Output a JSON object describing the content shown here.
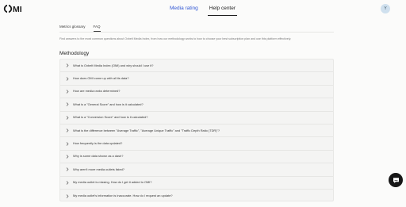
{
  "header": {
    "logo_text": "OMI",
    "nav": [
      {
        "label": "Media rating"
      },
      {
        "label": "Help center"
      }
    ],
    "avatar_initial": "Y",
    "colors": {
      "active_link": "#2f55d4",
      "avatar_bg": "#cfe0ee"
    }
  },
  "subnav": {
    "tabs": [
      {
        "label": "Metrics glossary"
      },
      {
        "label": "FAQ"
      }
    ]
  },
  "intro": "Find answers to the most common questions about Oxbelt Media Index, from how our methodology works to how to choose your best subscription plan and use this platform effectively.",
  "section": {
    "title": "Methodology",
    "questions": [
      "What is Oxbelt Media Index (OMI) and why should I use it?",
      "How does OMI come up with all its data?",
      "How are media ranks determined?",
      "What is a \"General Score\" and how is it calculated?",
      "What is a \"Conversion Score\" and how is it calculated?",
      "What is the difference between \"Average Traffic\", \"Average Unique Traffic\" and \"Traffic Depth Ratio (TDR)\"?",
      "How frequently is the data updated?",
      "Why is some data shown as a dash?",
      "Why aren't more media outlets listed?",
      "My media outlet is missing. How do I get it added to OMI?",
      "My media outlet's information is inaccurate. How do I request an update?"
    ]
  },
  "icons": {
    "faq_chevron": "chevron-right-icon",
    "chat": "chat-bubble-icon"
  }
}
